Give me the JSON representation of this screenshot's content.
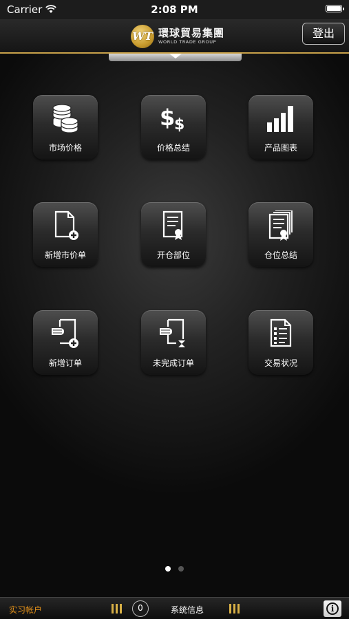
{
  "status_bar": {
    "carrier": "Carrier",
    "time": "2:08 PM"
  },
  "header": {
    "logo_letters": "WT",
    "logo_name_cn": "環球貿易集團",
    "logo_name_en": "WORLD TRADE GROUP",
    "logout_label": "登出"
  },
  "grid": {
    "items": [
      {
        "label": "市场价格",
        "icon": "coins-icon"
      },
      {
        "label": "价格总结",
        "icon": "dollar-signs-icon"
      },
      {
        "label": "产品图表",
        "icon": "bar-chart-icon"
      },
      {
        "label": "新增市价单",
        "icon": "new-document-plus-icon"
      },
      {
        "label": "开仓部位",
        "icon": "certificate-document-icon"
      },
      {
        "label": "仓位总结",
        "icon": "stacked-certificates-icon"
      },
      {
        "label": "新增订单",
        "icon": "hand-document-plus-icon"
      },
      {
        "label": "未完成订单",
        "icon": "hand-document-hourglass-icon"
      },
      {
        "label": "交易状况",
        "icon": "checklist-icon"
      }
    ]
  },
  "pagination": {
    "current_page": 1,
    "total_pages": 2
  },
  "bottom_bar": {
    "account_label": "实习帐户",
    "message_count": "0",
    "system_info_label": "系统信息"
  },
  "colors": {
    "accent_gold": "#c9a24a",
    "account_orange": "#e8941a"
  }
}
